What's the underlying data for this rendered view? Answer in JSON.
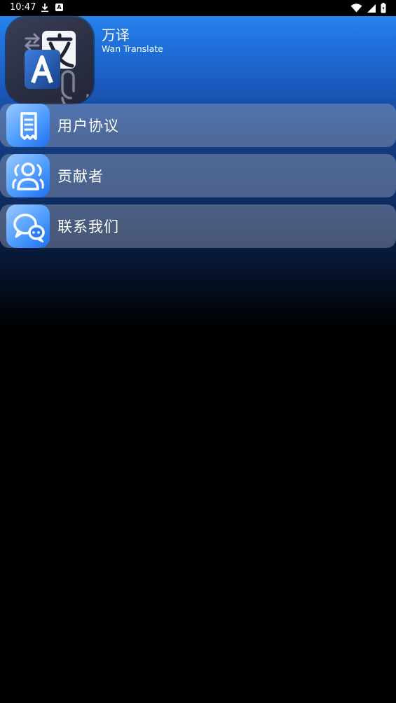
{
  "status_bar": {
    "time": "10:47",
    "icons": [
      "download-icon",
      "a-notification-icon",
      "wifi-icon",
      "signal-icon",
      "battery-icon"
    ]
  },
  "app": {
    "name": "万译",
    "subtitle": "Wan Translate"
  },
  "menu": {
    "items": [
      {
        "label": "用户协议",
        "icon": "document-icon"
      },
      {
        "label": "贡献者",
        "icon": "contributors-icon"
      },
      {
        "label": "联系我们",
        "icon": "chat-icon"
      }
    ]
  },
  "colors": {
    "header_gradient_top": "#2f8df7",
    "background": "#000000",
    "menu_item_bg": "#a0aabe",
    "icon_blue": "#4d9cff"
  }
}
